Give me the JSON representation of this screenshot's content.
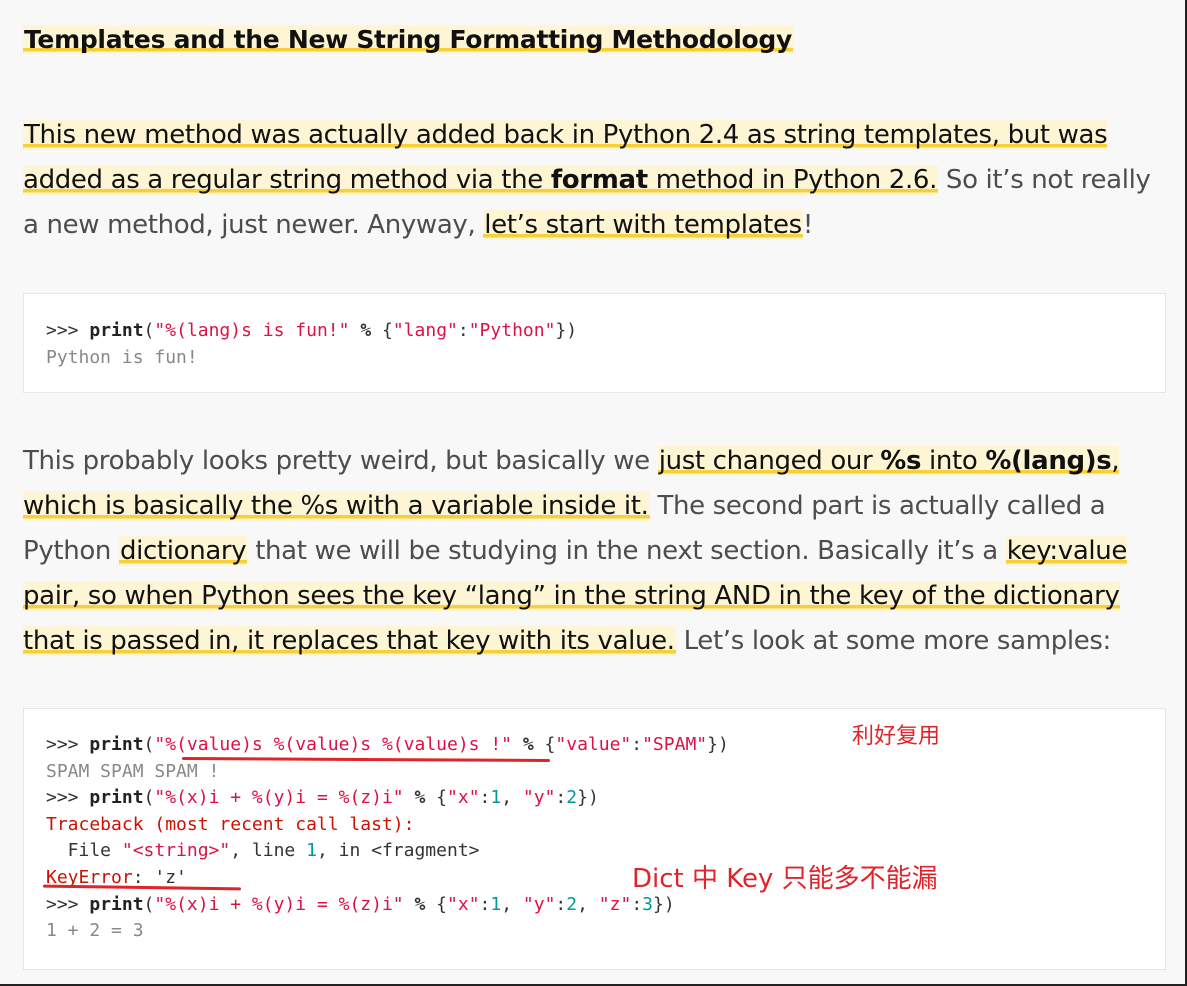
{
  "heading": "Templates and the New String Formatting Methodology",
  "p1": {
    "h1": "This new method was actually added back in Python 2.4 as string templates, but was added as a regular string method via the ",
    "h1_bold": "format",
    "h1_end": " method in Python 2.6.",
    "t1": " So it’s not really a new method, just newer. Anyway, ",
    "h2": "let’s start with templates",
    "t2": "!"
  },
  "code1": {
    "l1": {
      "prompt": ">>> ",
      "kw": "print",
      "p1": "(",
      "s1": "\"%(lang)s is fun!\"",
      "sp": " ",
      "op": "%",
      "p2": " {",
      "s2": "\"lang\"",
      "colon": ":",
      "s3": "\"Python\"",
      "p3": "})"
    },
    "l2": "Python is fun!"
  },
  "p2": {
    "t1": "This probably looks pretty weird, but basically we ",
    "h1a": "just changed our ",
    "h1b": "%s",
    "h1c": " into ",
    "h1d": "%(lang)s",
    "h1e": ", which is basically the %s with a variable inside it.",
    "t2": " The second part is actually called a Python ",
    "h2": "dictionary",
    "t3": " that we will be studying in the next section. Basically it’s a ",
    "h3": "key:value pair, so when Python sees the key “lang” in the string AND in the key of the dictionary that is passed in, it replaces that key with its value.",
    "t4": " Let’s look at some more samples:"
  },
  "code2": {
    "l1": {
      "prompt": ">>> ",
      "kw": "print",
      "p1": "(",
      "s1": "\"%(value)s %(value)s %(value)s !\"",
      "sp": " ",
      "op": "%",
      "p2": " {",
      "s2": "\"value\"",
      "colon": ":",
      "s3": "\"SPAM\"",
      "p3": "})"
    },
    "l2": "SPAM SPAM SPAM !",
    "l3": {
      "prompt": ">>> ",
      "kw": "print",
      "p1": "(",
      "s1": "\"%(x)i + %(y)i = %(z)i\"",
      "sp": " ",
      "op": "%",
      "p2": " {",
      "s2": "\"x\"",
      "c1": ":",
      "n1": "1",
      "cm1": ", ",
      "s3": "\"y\"",
      "c2": ":",
      "n2": "2",
      "p3": "})"
    },
    "l4": "Traceback (most recent call last):",
    "l5": {
      "a": "  File ",
      "s": "\"<string>\"",
      "b": ", line ",
      "n": "1",
      "c": ", in <fragment>"
    },
    "l6": {
      "a": "KeyError",
      "b": ": 'z'"
    },
    "l7": {
      "prompt": ">>> ",
      "kw": "print",
      "p1": "(",
      "s1": "\"%(x)i + %(y)i = %(z)i\"",
      "sp": " ",
      "op": "%",
      "p2": " {",
      "s2": "\"x\"",
      "c1": ":",
      "n1": "1",
      "cm1": ", ",
      "s3": "\"y\"",
      "c2": ":",
      "n2": "2",
      "cm2": ", ",
      "s4": "\"z\"",
      "c3": ":",
      "n3": "3",
      "p3": "})"
    },
    "l8": "1 + 2 = 3"
  },
  "annotations": {
    "a1": "利好复用",
    "a2": "Dict 中 Key 只能多不能漏"
  },
  "colors": {
    "highlight": "#fdf5d3",
    "underline": "#f7cf36",
    "annotation": "#e0242a",
    "string": "#dd1144",
    "number": "#009999"
  }
}
